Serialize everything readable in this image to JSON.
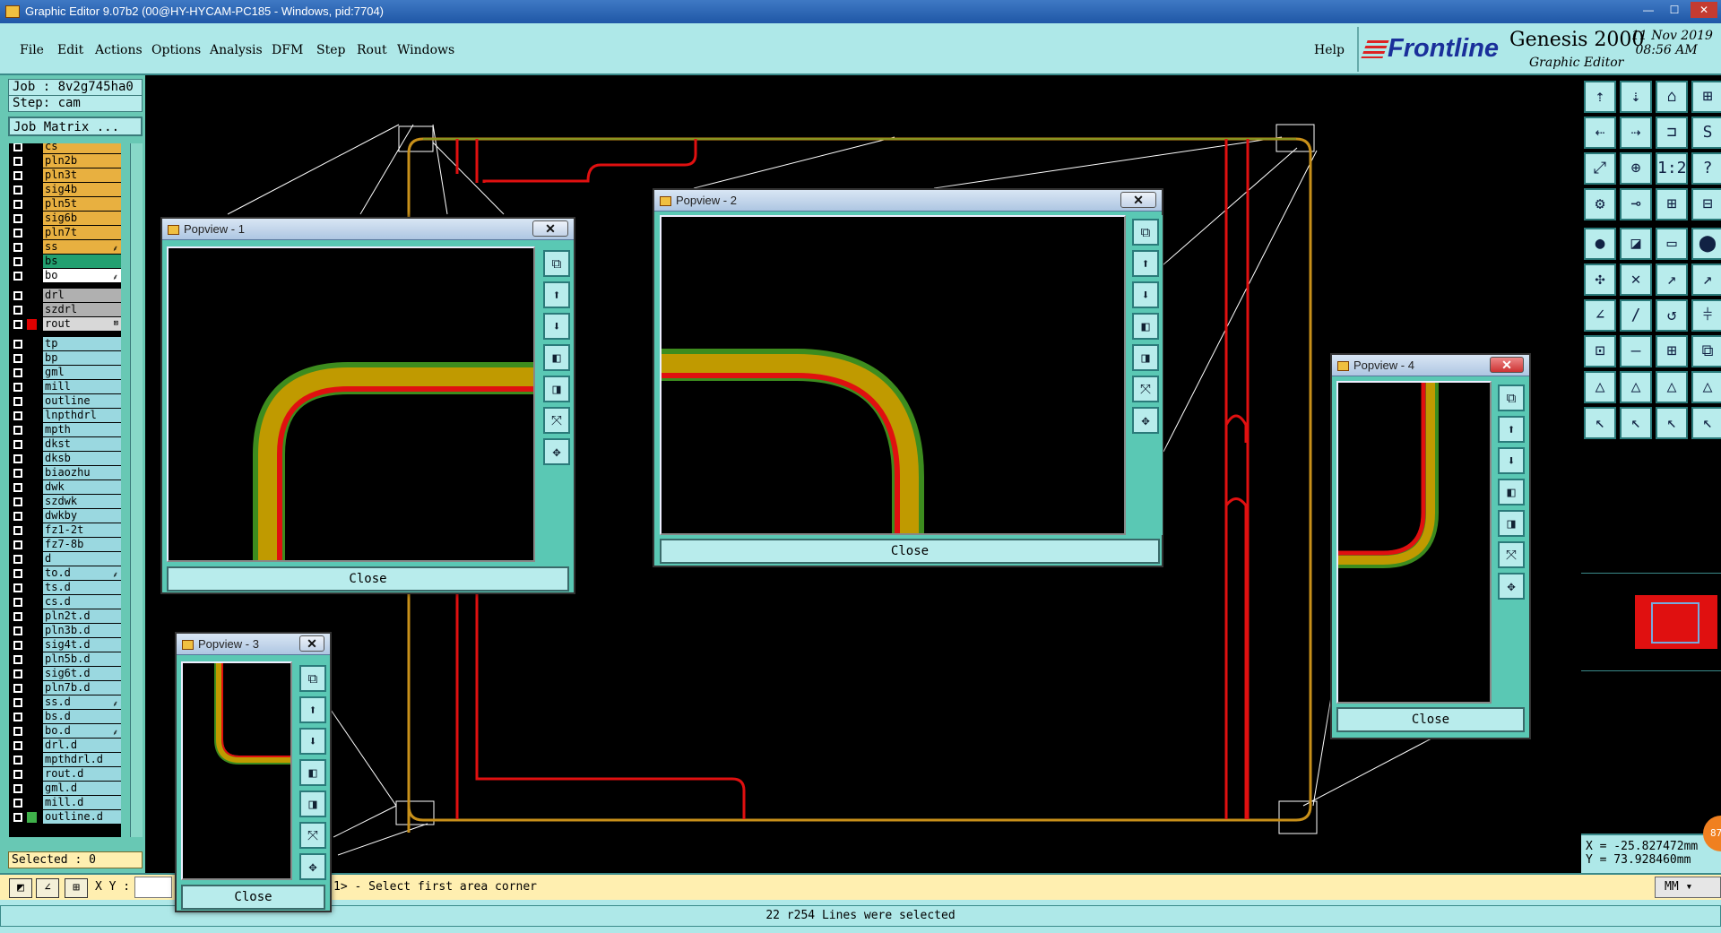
{
  "window": {
    "title": "Graphic Editor 9.07b2 (00@HY-HYCAM-PC185 - Windows, pid:7704)",
    "min": "—",
    "max": "☐",
    "close": "✕"
  },
  "menu": [
    "File",
    "Edit",
    "Actions",
    "Options",
    "Analysis",
    "DFM",
    "Step",
    "Rout",
    "Windows"
  ],
  "help": "Help",
  "brand": {
    "logo": "Frontline",
    "product": "Genesis 2000",
    "subtitle": "Graphic Editor",
    "date": "11 Nov 2019",
    "time": "08:56 AM"
  },
  "job": {
    "label": "Job : 8v2g745ha0",
    "step": "Step: cam",
    "matrix": "Job Matrix ..."
  },
  "layers": [
    {
      "name": "cs",
      "color": "#e8b040",
      "flag": ""
    },
    {
      "name": "pln2b",
      "color": "#e8b040",
      "flag": ""
    },
    {
      "name": "pln3t",
      "color": "#e8b040",
      "flag": ""
    },
    {
      "name": "sig4b",
      "color": "#e8b040",
      "flag": ""
    },
    {
      "name": "pln5t",
      "color": "#e8b040",
      "flag": ""
    },
    {
      "name": "sig6b",
      "color": "#e8b040",
      "flag": ""
    },
    {
      "name": "pln7t",
      "color": "#e8b040",
      "flag": ""
    },
    {
      "name": "ss",
      "color": "#e8b040",
      "flag": "⸙"
    },
    {
      "name": "bs",
      "color": "#22a070",
      "flag": ""
    },
    {
      "name": "bo",
      "color": "#ffffff",
      "flag": "⸙"
    },
    {
      "name": "drl",
      "color": "#b0b0b0",
      "flag": ""
    },
    {
      "name": "szdrl",
      "color": "#b0b0b0",
      "flag": ""
    },
    {
      "name": "rout",
      "color": "#d8d8d8",
      "flag": "⊠",
      "swatch": "#e00000"
    },
    {
      "name": "tp",
      "color": "#9ad8e0",
      "flag": ""
    },
    {
      "name": "bp",
      "color": "#9ad8e0",
      "flag": ""
    },
    {
      "name": "gml",
      "color": "#9ad8e0",
      "flag": ""
    },
    {
      "name": "mill",
      "color": "#9ad8e0",
      "flag": ""
    },
    {
      "name": "outline",
      "color": "#9ad8e0",
      "flag": ""
    },
    {
      "name": "lnpthdrl",
      "color": "#9ad8e0",
      "flag": ""
    },
    {
      "name": "mpth",
      "color": "#9ad8e0",
      "flag": ""
    },
    {
      "name": "dkst",
      "color": "#9ad8e0",
      "flag": ""
    },
    {
      "name": "dksb",
      "color": "#9ad8e0",
      "flag": ""
    },
    {
      "name": "biaozhu",
      "color": "#9ad8e0",
      "flag": ""
    },
    {
      "name": "dwk",
      "color": "#9ad8e0",
      "flag": ""
    },
    {
      "name": "szdwk",
      "color": "#9ad8e0",
      "flag": ""
    },
    {
      "name": "dwkby",
      "color": "#9ad8e0",
      "flag": ""
    },
    {
      "name": "fz1-2t",
      "color": "#9ad8e0",
      "flag": ""
    },
    {
      "name": "fz7-8b",
      "color": "#9ad8e0",
      "flag": ""
    },
    {
      "name": "d",
      "color": "#9ad8e0",
      "flag": ""
    },
    {
      "name": "to.d",
      "color": "#9ad8e0",
      "flag": "⸙"
    },
    {
      "name": "ts.d",
      "color": "#9ad8e0",
      "flag": ""
    },
    {
      "name": "cs.d",
      "color": "#9ad8e0",
      "flag": ""
    },
    {
      "name": "pln2t.d",
      "color": "#9ad8e0",
      "flag": ""
    },
    {
      "name": "pln3b.d",
      "color": "#9ad8e0",
      "flag": ""
    },
    {
      "name": "sig4t.d",
      "color": "#9ad8e0",
      "flag": ""
    },
    {
      "name": "pln5b.d",
      "color": "#9ad8e0",
      "flag": ""
    },
    {
      "name": "sig6t.d",
      "color": "#9ad8e0",
      "flag": ""
    },
    {
      "name": "pln7b.d",
      "color": "#9ad8e0",
      "flag": ""
    },
    {
      "name": "ss.d",
      "color": "#9ad8e0",
      "flag": "⸙"
    },
    {
      "name": "bs.d",
      "color": "#9ad8e0",
      "flag": ""
    },
    {
      "name": "bo.d",
      "color": "#9ad8e0",
      "flag": "⸙"
    },
    {
      "name": "drl.d",
      "color": "#9ad8e0",
      "flag": ""
    },
    {
      "name": "mpthdrl.d",
      "color": "#9ad8e0",
      "flag": ""
    },
    {
      "name": "rout.d",
      "color": "#9ad8e0",
      "flag": ""
    },
    {
      "name": "gml.d",
      "color": "#9ad8e0",
      "flag": ""
    },
    {
      "name": "mill.d",
      "color": "#9ad8e0",
      "flag": ""
    },
    {
      "name": "outline.d",
      "color": "#9ad8e0",
      "flag": "",
      "swatch": "#3fb04a"
    }
  ],
  "selected": "Selected : 0",
  "popups": {
    "p1": {
      "title": "Popview - 1",
      "close": "Close",
      "x": "✕"
    },
    "p2": {
      "title": "Popview - 2",
      "close": "Close",
      "x": "✕"
    },
    "p3": {
      "title": "Popview - 3",
      "close": "Close",
      "x": "✕"
    },
    "p4": {
      "title": "Popview - 4",
      "close": "Close",
      "x": "✕"
    }
  },
  "popup_buttons": [
    "⧉",
    "⬆",
    "⬇",
    "◧",
    "◨",
    "⤧",
    "✥"
  ],
  "toolbox": [
    "⇡",
    "⇣",
    "⌂",
    "⊞",
    "⇠",
    "⇢",
    "⊐",
    "S",
    "⤢",
    "⊕",
    "1:2",
    "?",
    "⚙",
    "⊸",
    "⊞",
    "⊟",
    "●",
    "◪",
    "▭",
    "⬤",
    "✣",
    "✕",
    "↗",
    "↗",
    "∠",
    "/",
    "↺",
    "⫩",
    "⊡",
    "—",
    "⊞",
    "⧉",
    "△",
    "△",
    "△",
    "△",
    "↖",
    "↖",
    "↖",
    "↖"
  ],
  "coords": {
    "x": "X = -25.827472mm",
    "y": "Y = 73.928460mm"
  },
  "badge": "87",
  "cmd": {
    "xy": "X Y :",
    "prompt": "1> - Select first area corner",
    "unit": "MM ▾"
  },
  "status": "22 r254 Lines were selected"
}
